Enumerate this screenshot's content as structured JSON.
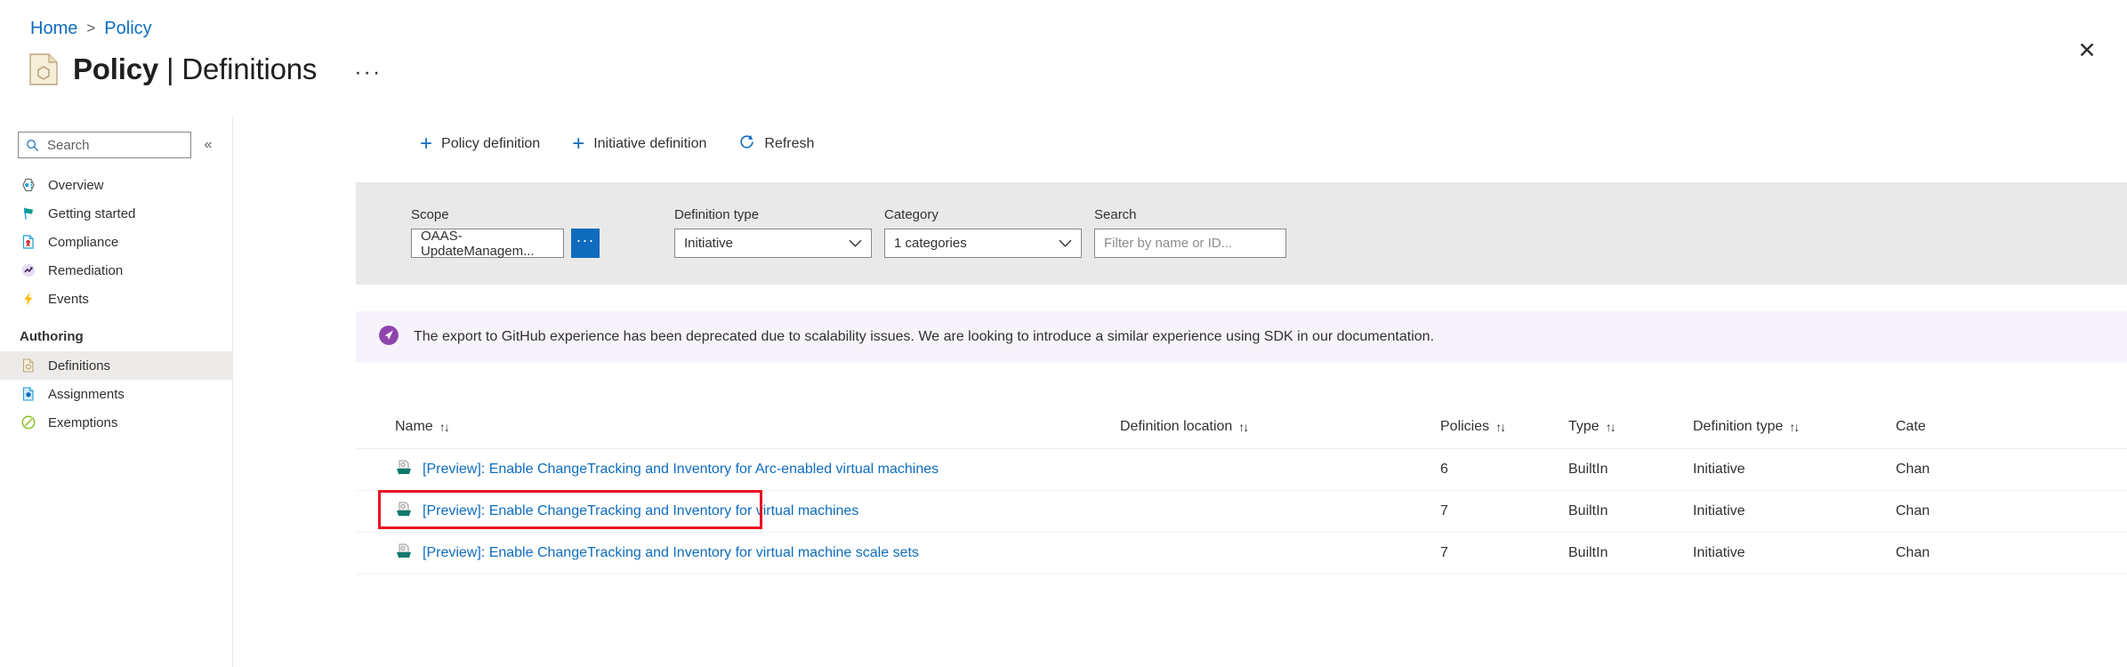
{
  "breadcrumb": {
    "home": "Home",
    "separator": ">",
    "current": "Policy"
  },
  "header": {
    "title_main": "Policy",
    "title_sep": "|",
    "title_sub": "Definitions",
    "more_label": "···",
    "close_label": "✕",
    "icon": "policy-definition-icon"
  },
  "sidebar": {
    "search_placeholder": "Search",
    "collapse_label": "«",
    "items": [
      {
        "label": "Overview",
        "icon": "overview-icon",
        "selected": false
      },
      {
        "label": "Getting started",
        "icon": "flag-icon",
        "selected": false
      },
      {
        "label": "Compliance",
        "icon": "compliance-icon",
        "selected": false
      },
      {
        "label": "Remediation",
        "icon": "remediation-icon",
        "selected": false
      },
      {
        "label": "Events",
        "icon": "lightning-icon",
        "selected": false
      }
    ],
    "group_label": "Authoring",
    "authoring_items": [
      {
        "label": "Definitions",
        "icon": "definitions-icon",
        "selected": true
      },
      {
        "label": "Assignments",
        "icon": "assignments-icon",
        "selected": false
      },
      {
        "label": "Exemptions",
        "icon": "exemptions-icon",
        "selected": false
      }
    ]
  },
  "toolbar": {
    "policy_definition": "Policy definition",
    "initiative_definition": "Initiative definition",
    "refresh": "Refresh",
    "plus_glyph": "+",
    "refresh_glyph": "↻"
  },
  "filters": {
    "scope": {
      "label": "Scope",
      "value": "OAAS-UpdateManagem...",
      "browse_label": "···"
    },
    "definition_type": {
      "label": "Definition type",
      "value": "Initiative"
    },
    "category": {
      "label": "Category",
      "value": "1 categories"
    },
    "search": {
      "label": "Search",
      "placeholder": "Filter by name or ID...",
      "value": ""
    }
  },
  "banner": {
    "icon": "megaphone-icon",
    "text": "The export to GitHub experience has been deprecated due to scalability issues. We are looking to introduce a similar experience using SDK in our documentation."
  },
  "table": {
    "sort_glyph": "↑↓",
    "columns": [
      {
        "key": "name",
        "label": "Name"
      },
      {
        "key": "location",
        "label": "Definition location"
      },
      {
        "key": "policies",
        "label": "Policies"
      },
      {
        "key": "type",
        "label": "Type"
      },
      {
        "key": "definition_type",
        "label": "Definition type"
      },
      {
        "key": "category",
        "label": "Cate"
      }
    ],
    "rows": [
      {
        "name": "[Preview]: Enable ChangeTracking and Inventory for Arc-enabled virtual machines",
        "location": "",
        "policies": "6",
        "type": "BuiltIn",
        "definition_type": "Initiative",
        "category": "Chan",
        "highlighted": false
      },
      {
        "name": "[Preview]: Enable ChangeTracking and Inventory for virtual machines",
        "location": "",
        "policies": "7",
        "type": "BuiltIn",
        "definition_type": "Initiative",
        "category": "Chan",
        "highlighted": true
      },
      {
        "name": "[Preview]: Enable ChangeTracking and Inventory for virtual machine scale sets",
        "location": "",
        "policies": "7",
        "type": "BuiltIn",
        "definition_type": "Initiative",
        "category": "Chan",
        "highlighted": false
      }
    ]
  },
  "colors": {
    "link": "#0f6cbd",
    "highlight": "#e81123",
    "banner_bg": "#f7f3fb",
    "filter_bg": "#e9e9e9",
    "selected_nav": "#edebe9"
  }
}
